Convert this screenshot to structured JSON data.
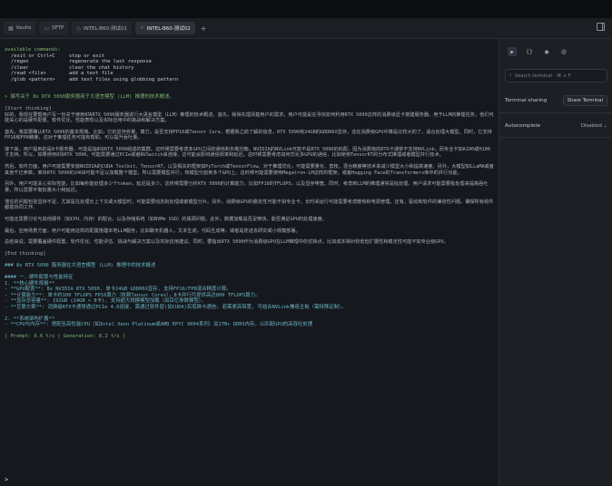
{
  "tabs": {
    "vaults": "Vaults",
    "sftp": "SFTP",
    "tab1": "INTEL-B60-测试01",
    "tab2": "INTEL-B60-测试02",
    "add": "+"
  },
  "terminal": {
    "header": "available commands:",
    "commands": [
      {
        "cmd": "/exit or Ctrl+C",
        "desc": "stop or exit"
      },
      {
        "cmd": "/regen",
        "desc": "regenerate the last response"
      },
      {
        "cmd": "/clear",
        "desc": "clear the chat history"
      },
      {
        "cmd": "/read <file>",
        "desc": "add a text file"
      },
      {
        "cmd": "/glob <pattern>",
        "desc": "add text files using globbing pattern"
      }
    ],
    "user_prompt": "> 撰写关于 8x RTX 5090服务器用于大语言模型 (LLM) 推理的技术概述。",
    "start_thinking": "[Start thinking]",
    "thinking_paragraphs": [
      "好的，我现在要帮用户写一份关于使用8块RTX 5090服务器进行大语言模型（LLM）推理的技术概述。首先，我得先理清楚用户的需求。用户可能是在寻找如何利用RTX 5090这样的消费级显卡搭建服务器，用于LLM的推理任务。他们可能关心的是硬件配置、软件优化、性能表现以及实际应用中的挑战和解决方案。",
      "首先，我需要确认RTX 5090的基本规格。比如，它的显存容量、算力，是否支持FP16或Tensor Core，根据我之前了解的信息，RTX 5090有24GB的GDDR6X显存，这在消费级GPU中算是比较大的了，适合处理大模型。同时，它支持FP16和FP8精度，这对于推理任务可能有帮助，可以提升吞吐量。",
      "接下来，用户提到的是8卡服务器，可能是指8块RTX 5090组成的集群。这时候需要考虑多GPU之间的通信和负载均衡。NVIDIA的NVLink可能不是RTX 5090的标配，因为消费级的RTX卡通常不支持NVLink，而专业卡如A100或H100才支持。所以，如果使用8块RTX 5090，可能需要通过PCIe或者NVSwitch来连接，这可能会影响通信效率和延迟。这时候需要考虑如何优化多GPU的通信，比如使用TensorRT的分布式推理或者模型并行技术。",
      "然后，软件方面，用户可能需要安装NVIDIA的CUDA Toolkit、TensorRT，以及相关的框架如PyTorch或TensorFlow。对于推理优化，可能需要量化、剪枝，混合精度等技术来减少模型大小和提高速度。另外，大模型如LLaMA或者其他千亿参数，单块RTX 5090的24GB可能不足以加载整个模型，所以需要模型并行，将模型分割到多个GPU上。这时候可能需要使用Megatron-LM这样的框架，或者Hugging Face的Transformers库中的并行功能。",
      "另外，用户可能关心实际性能，比如每秒能处理多少个token，延迟是多少。这时候需要分析RTX 5090的计算能力，比如FP16的TFLOPS，以及显存带宽。同时，考虑到LLM的推理通常是批处理，用户请求可能需要批处理来提高吞吐量，所以需要平衡批量大小和延迟。",
      "潜在的问题包括显存不足，尤其是在处理长上下文或大模型时，可能需要动态批处理或者模型分片。另外，消费级GPU的稳定性可能不如专业卡，长时间运行可能需要考虑散热和电源管理。还有，驱动和软件的兼容性问题，确保所有组件都能协同工作。",
      "可能还需要讨论与其他硬件（如CPU、内存）的配合，以及存储系统（如NVMe SSD）的瓶颈问题。此外，数据加载是否足够快，能否满足GPU的处理速度。",
      "最后，应用场景方面，用户可能用这样的配置搭建本地LLM服务，比如聊天机器人，文本生成，代码生成等，或者是迭进去研究或小规模部署。",
      "总结来说，需要覆盖硬件配置、软件优化、性能评估、挑战与解决方案以及实际应用建议。同时，要指出RTX 5090作为消费级GPU在LLM推理中的优缺点，比如成本相对较低但扩展性和稳定性可能不如专业级GPU。"
    ],
    "end_thinking": "[End thinking]",
    "answer_title": "### 8x RTX 5090 服务器在大语言模型 (LLM) 推理中的技术概述",
    "section1_title": "#### 一、硬件配置与性能特征",
    "item1": "1. **核心硬件规格**",
    "bullets1": [
      "- **GPU配置**: 8x NVIDIA RTX 5090, 单卡24GB GDDR6X显存, 支持FP16/FP8混合精度计算。",
      "- **计算能力**: 单卡约100 TFLOPS FP16算力（依赖Tensor Cores），8卡并行可提供高达800 TFLOPS算力。",
      "- **显存总容量**: 192GB (24GB × 8卡), 支持超大规模模型加载（如百亿参数模型）。",
      "- **互联方案**: 消费级RTX卡通常通过PCIe 4.0连接, 需通过软件层(如CUDA)实现跨卡通信; 若需更高带宽, 可结合NVLink兼容主板（需特殊定制）。"
    ],
    "item2": "2. **系统架构扩展**",
    "bullets2": [
      "- **CPU与内存**: 搭配至高性能CPU（如Intel Xeon Platinum或AMD EPYC 9004系列）及1TB+ DDR5内存，以匹配GPU的高吞吐处理"
    ],
    "stats": "[ Prompt: 6.6 t/s | Generation: 8.2 t/s ]",
    "prompt_symbol": ">"
  },
  "sidebar": {
    "search_placeholder": "Search terminal · ⌘ + F",
    "terminal_sharing_label": "Terminal sharing",
    "share_button": "Share Terminal",
    "autocomplete_label": "Autocomplete",
    "autocomplete_value": "Disabled"
  }
}
